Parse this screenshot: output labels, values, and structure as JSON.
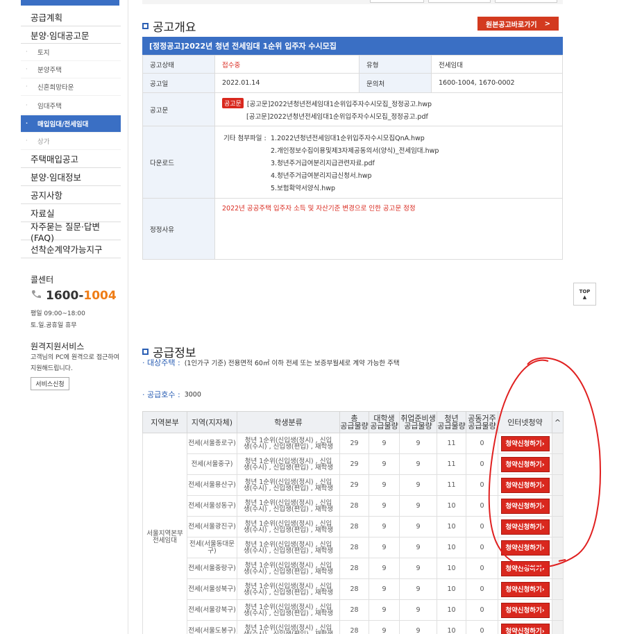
{
  "sidebar": {
    "menu": [
      {
        "label": "공급계획"
      },
      {
        "label": "분양·임대공고문"
      }
    ],
    "submenu": [
      {
        "label": "토지"
      },
      {
        "label": "분양주택"
      },
      {
        "label": "신혼희망타운"
      },
      {
        "label": "임대주택"
      },
      {
        "label": "매입임대/전세임대"
      },
      {
        "label": "상가"
      }
    ],
    "menu2": [
      {
        "label": "주택매입공고"
      },
      {
        "label": "분양·임대정보"
      },
      {
        "label": "공지사항"
      },
      {
        "label": "자료실"
      },
      {
        "label": "자주묻는 질문·답변(FAQ)"
      },
      {
        "label": "선착순계약가능지구"
      }
    ],
    "callcenter": {
      "title": "콜센터",
      "phone_a": "1600-",
      "phone_b": "1004",
      "hours": "평일 09:00~18:00",
      "holiday": "토.일.공휴일 휴무"
    },
    "remote": {
      "title": "원격지원서비스",
      "desc": "고객님의 PC에 원격으로 접근하여 지원해드립니다.",
      "button": "서비스신청"
    }
  },
  "notice": {
    "section_title": "공고개요",
    "orig_button": "원본공고바로가기",
    "orig_arrow": ">",
    "title": "[정정공고]2022년 청년 전세임대 1순위 입주자 수시모집",
    "status_label": "공고상태",
    "status_value": "접수중",
    "type_label": "유형",
    "type_value": "전세임대",
    "date_label": "공고일",
    "date_value": "2022.01.14",
    "contact_label": "문의처",
    "contact_value": "1600-1004, 1670-0002",
    "doc_label": "공고문",
    "doc_tag": "공고문",
    "doc_files": [
      "[공고문]2022년청년전세임대1순위입주자수시모집_정정공고.hwp",
      "[공고문]2022년청년전세임대1순위입주자수시모집_정정공고.pdf"
    ],
    "download_label": "다운로드",
    "download_prefix": "기타 첨부파일 :",
    "download_files": [
      "1.2022년청년전세임대1순위입주자수시모집QnA.hwp",
      "2.개인정보수집이용및제3자제공동의서(양식)_전세임대.hwp",
      "3.청년주거급여분리지급관련자료.pdf",
      "4.청년주거급여분리지급신청서.hwp",
      "5.보험확약서양식.hwp"
    ],
    "reason_label": "정정사유",
    "reason_text": "2022년 공공주택 입주자 소득 및 자산기준 변경으로 인한 공고문 정정"
  },
  "top_button": {
    "label": "TOP",
    "arrow": "▲"
  },
  "supply": {
    "section_title": "공급정보",
    "target_key": "대상주택 :",
    "target_value": "(1인가구 기준) 전용면적 60㎡ 이하 전세 또는 보증부월세로 계약 가능한 주택",
    "count_key": "공급호수 :",
    "count_value": "3000",
    "headers": {
      "region": "지역본부",
      "area": "지역(지자체)",
      "class": "학생분류",
      "total_a": "총",
      "total_b": "공급물량",
      "univ_a": "대학생",
      "univ_b": "공급물량",
      "job_a": "취업준비생",
      "job_b": "공급물량",
      "youth_a": "청년",
      "youth_b": "공급물량",
      "joint_a": "공동거주",
      "joint_b": "공급물량",
      "apply": "인터넷청약"
    },
    "scroll_up": "^",
    "region_label": "서울지역본부 전세임대",
    "class_text_a": "청년 1순위(신입생(정시) , 신입",
    "class_text_b": "생(수시) , 신입생(편입) , 재학생",
    "apply_label": "청약신청하기›",
    "rows": [
      {
        "area": "전세(서울종로구)",
        "total": "29",
        "univ": "9",
        "job": "9",
        "youth": "11",
        "joint": "0"
      },
      {
        "area": "전세(서울중구)",
        "total": "29",
        "univ": "9",
        "job": "9",
        "youth": "11",
        "joint": "0"
      },
      {
        "area": "전세(서울용산구)",
        "total": "29",
        "univ": "9",
        "job": "9",
        "youth": "11",
        "joint": "0"
      },
      {
        "area": "전세(서울성동구)",
        "total": "28",
        "univ": "9",
        "job": "9",
        "youth": "10",
        "joint": "0"
      },
      {
        "area": "전세(서울광진구)",
        "total": "28",
        "univ": "9",
        "job": "9",
        "youth": "10",
        "joint": "0"
      },
      {
        "area": "전세(서울동대문구)",
        "total": "28",
        "univ": "9",
        "job": "9",
        "youth": "10",
        "joint": "0"
      },
      {
        "area": "전세(서울중랑구)",
        "total": "28",
        "univ": "9",
        "job": "9",
        "youth": "10",
        "joint": "0"
      },
      {
        "area": "전세(서울성북구)",
        "total": "28",
        "univ": "9",
        "job": "9",
        "youth": "10",
        "joint": "0"
      },
      {
        "area": "전세(서울강북구)",
        "total": "28",
        "univ": "9",
        "job": "9",
        "youth": "10",
        "joint": "0"
      },
      {
        "area": "전세(서울도봉구)",
        "total": "28",
        "univ": "9",
        "job": "9",
        "youth": "10",
        "joint": "0"
      }
    ]
  }
}
